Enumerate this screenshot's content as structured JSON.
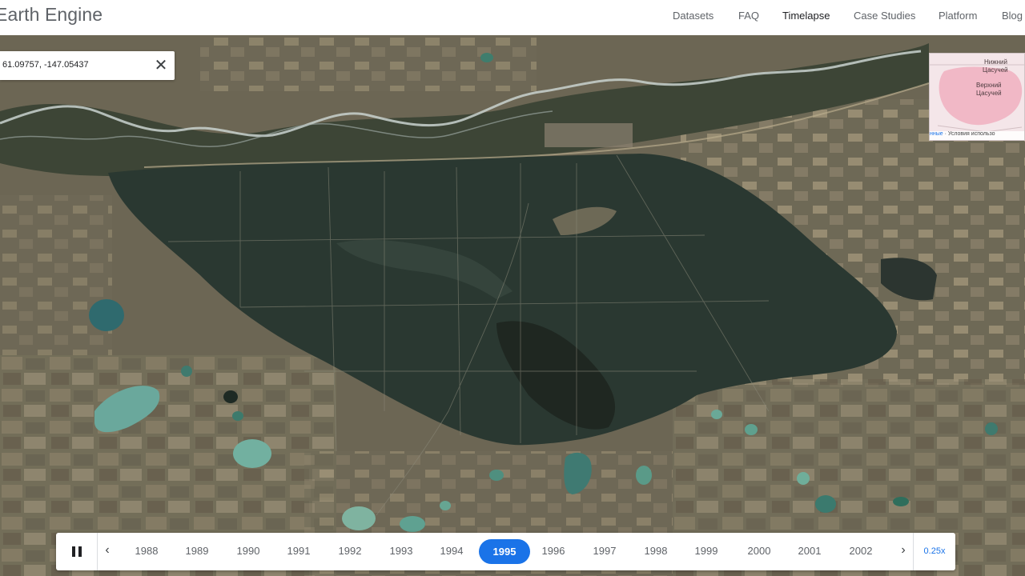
{
  "header": {
    "brand": "Earth Engine",
    "nav": [
      {
        "label": "Datasets",
        "active": false
      },
      {
        "label": "FAQ",
        "active": false
      },
      {
        "label": "Timelapse",
        "active": true
      },
      {
        "label": "Case Studies",
        "active": false
      },
      {
        "label": "Platform",
        "active": false
      },
      {
        "label": "Blog",
        "active": false
      }
    ]
  },
  "search": {
    "value": "61.09757, -147.05437",
    "close_icon": "close-icon"
  },
  "minimap": {
    "labels": [
      "Нижний",
      "Цасучей",
      "Верхний",
      "Цасучей"
    ],
    "footer_link": "нные",
    "footer_text": "Условия использо"
  },
  "timeline": {
    "years": [
      "1988",
      "1989",
      "1990",
      "1991",
      "1992",
      "1993",
      "1994",
      "1995",
      "1996",
      "1997",
      "1998",
      "1999",
      "2000",
      "2001",
      "2002"
    ],
    "selected_year": "1995",
    "speed": "0.25x",
    "play_state": "playing"
  },
  "colors": {
    "accent": "#1a73e8",
    "forest": "#2c3b34",
    "steppe": "#7b735d",
    "lake": "#6aa89c"
  }
}
